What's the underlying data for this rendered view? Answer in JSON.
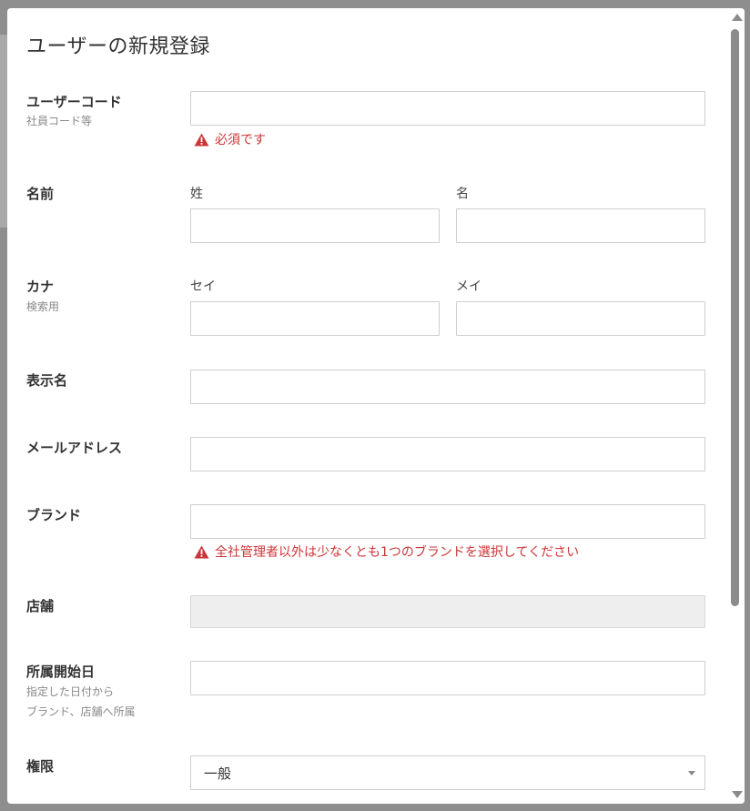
{
  "modal": {
    "title": "ユーザーの新規登録"
  },
  "form": {
    "user_code": {
      "label": "ユーザーコード",
      "hint": "社員コード等",
      "value": "",
      "error": "必須です"
    },
    "name": {
      "label": "名前",
      "last_label": "姓",
      "first_label": "名",
      "last_value": "",
      "first_value": ""
    },
    "kana": {
      "label": "カナ",
      "hint": "検索用",
      "last_label": "セイ",
      "first_label": "メイ",
      "last_value": "",
      "first_value": ""
    },
    "display_name": {
      "label": "表示名",
      "value": ""
    },
    "email": {
      "label": "メールアドレス",
      "value": ""
    },
    "brand": {
      "label": "ブランド",
      "value": "",
      "error": "全社管理者以外は少なくとも1つのブランドを選択してください"
    },
    "store": {
      "label": "店舗",
      "value": ""
    },
    "start_date": {
      "label": "所属開始日",
      "hint_line1": "指定した日付から",
      "hint_line2": "ブランド、店舗へ所属",
      "value": ""
    },
    "permission": {
      "label": "権限",
      "selected": "一般"
    }
  },
  "colors": {
    "error": "#cc3535",
    "overlay": "#8e8e8e"
  },
  "icons": {
    "warning": "warning-icon",
    "caret": "chevron-down-icon"
  }
}
